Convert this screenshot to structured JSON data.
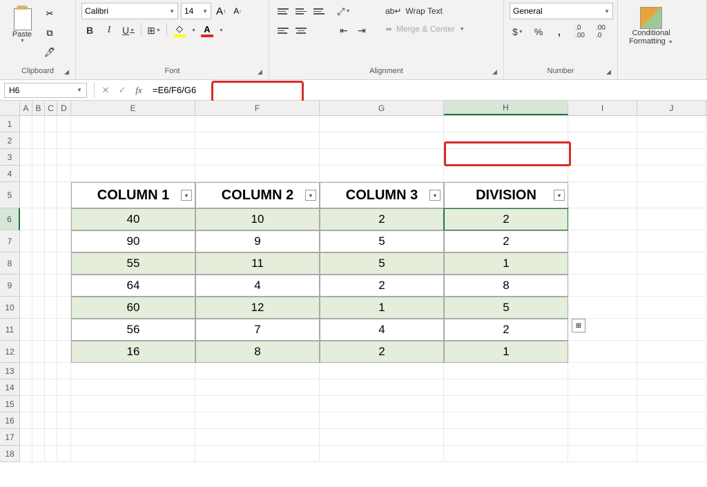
{
  "ribbon": {
    "clipboard": {
      "paste": "Paste",
      "label": "Clipboard"
    },
    "font": {
      "name": "Calibri",
      "size": "14",
      "bold": "B",
      "italic": "I",
      "underline": "U",
      "label": "Font"
    },
    "alignment": {
      "wrap": "Wrap Text",
      "merge": "Merge & Center",
      "label": "Alignment"
    },
    "number": {
      "format": "General",
      "label": "Number"
    },
    "styles": {
      "conditional": "Conditional",
      "formatting": "Formatting",
      "label": ""
    }
  },
  "nameBox": "H6",
  "formula": "=E6/F6/G6",
  "columns": [
    "A",
    "B",
    "C",
    "D",
    "E",
    "F",
    "G",
    "H",
    "I",
    "J"
  ],
  "rowNums": [
    "1",
    "2",
    "3",
    "4",
    "5",
    "6",
    "7",
    "8",
    "9",
    "10",
    "11",
    "12",
    "13",
    "14",
    "15",
    "16",
    "17",
    "18"
  ],
  "table": {
    "headers": [
      "COLUMN 1",
      "COLUMN 2",
      "COLUMN 3",
      "DIVISION"
    ],
    "rows": [
      [
        "40",
        "10",
        "2",
        "2"
      ],
      [
        "90",
        "9",
        "5",
        "2"
      ],
      [
        "55",
        "11",
        "5",
        "1"
      ],
      [
        "64",
        "4",
        "2",
        "8"
      ],
      [
        "60",
        "12",
        "1",
        "5"
      ],
      [
        "56",
        "7",
        "4",
        "2"
      ],
      [
        "16",
        "8",
        "2",
        "1"
      ]
    ]
  },
  "chart_data": {
    "type": "table",
    "title": "Division table",
    "columns": [
      "COLUMN 1",
      "COLUMN 2",
      "COLUMN 3",
      "DIVISION"
    ],
    "rows": [
      [
        40,
        10,
        2,
        2
      ],
      [
        90,
        9,
        5,
        2
      ],
      [
        55,
        11,
        5,
        1
      ],
      [
        64,
        4,
        2,
        8
      ],
      [
        60,
        12,
        1,
        5
      ],
      [
        56,
        7,
        4,
        2
      ],
      [
        16,
        8,
        2,
        1
      ]
    ],
    "formula": "=E6/F6/G6",
    "active_cell": "H6"
  }
}
